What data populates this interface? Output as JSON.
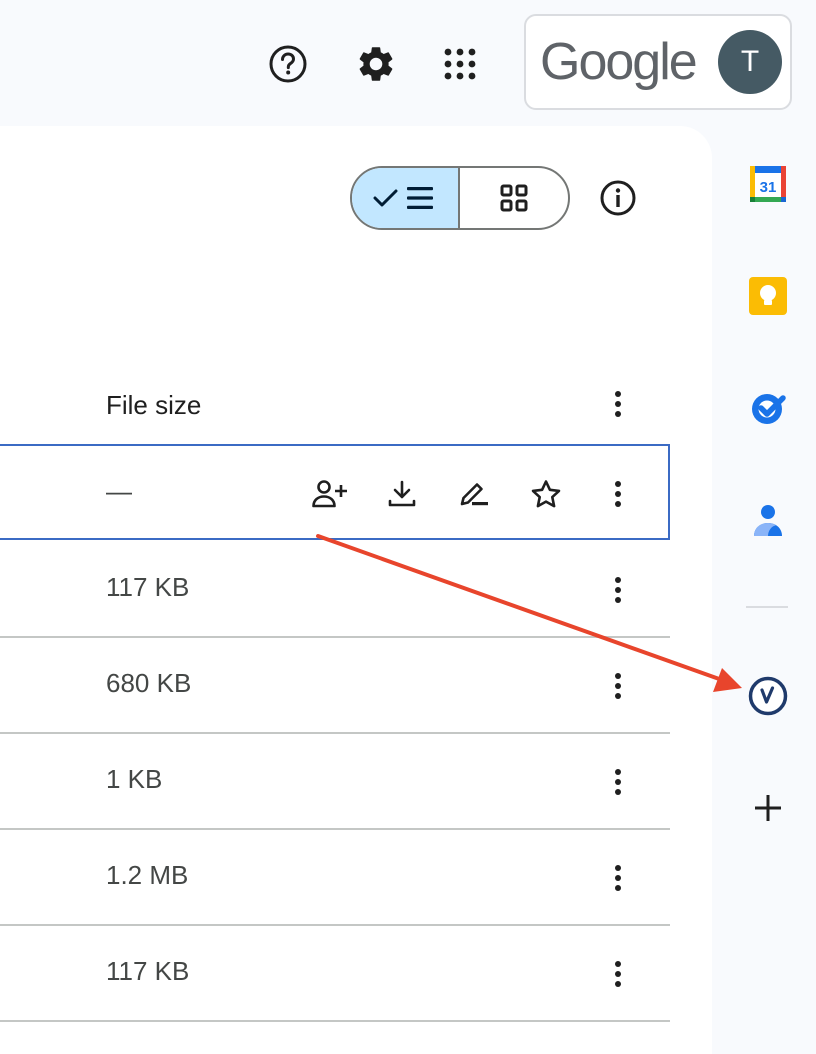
{
  "topbar": {
    "help_icon": "help-circle-icon",
    "settings_icon": "gear-icon",
    "apps_icon": "apps-grid-icon",
    "account": {
      "brand_text": "Google",
      "avatar_initial": "T"
    }
  },
  "toolbar": {
    "view_toggle": {
      "list_icon": "check-list-icon",
      "grid_icon": "grid-icon",
      "active": "list"
    },
    "info_icon": "info-icon"
  },
  "table": {
    "header": {
      "file_size": "File size"
    },
    "rows": [
      {
        "size": "—",
        "selected": true
      },
      {
        "size": "117 KB"
      },
      {
        "size": "680 KB"
      },
      {
        "size": "1 KB"
      },
      {
        "size": "1.2 MB"
      },
      {
        "size": "117 KB"
      }
    ],
    "row_actions": [
      "share-person-add-icon",
      "download-icon",
      "rename-pencil-icon",
      "star-icon",
      "more-vert-icon"
    ]
  },
  "side_panel": {
    "apps": [
      {
        "name": "calendar",
        "label": "31",
        "color": "#1a73e8"
      },
      {
        "name": "keep",
        "color": "#fbbc04"
      },
      {
        "name": "tasks",
        "color": "#1a73e8"
      },
      {
        "name": "contacts",
        "color": "#1a73e8"
      },
      {
        "name": "addon",
        "color": "#1f3a6b"
      }
    ],
    "add_icon": "plus-icon"
  },
  "annotation": {
    "type": "arrow",
    "color": "#e8452c"
  }
}
